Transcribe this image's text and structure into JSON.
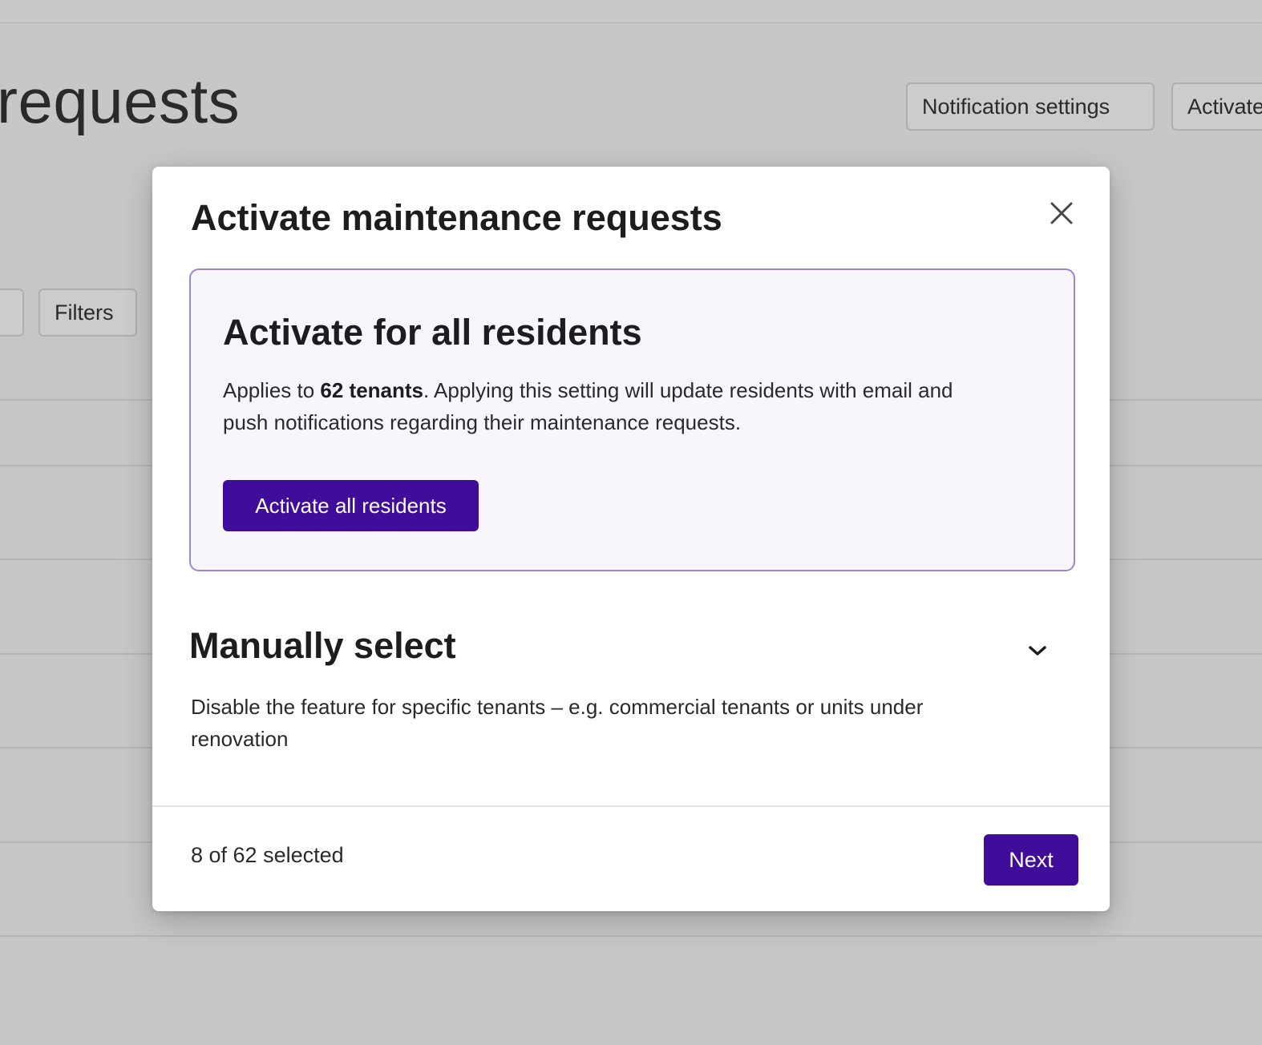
{
  "background": {
    "page_title": "requests",
    "notification_settings_label": "Notification settings",
    "activate_label": "Activate",
    "filters_label": "Filters"
  },
  "modal": {
    "title": "Activate maintenance requests",
    "all_residents": {
      "title": "Activate for all residents",
      "desc_prefix": "Applies to ",
      "tenant_count": "62 tenants",
      "desc_suffix": ". Applying this setting will update residents with email and push notifications regarding their maintenance requests.",
      "button_label": "Activate all residents"
    },
    "manual": {
      "title": "Manually select",
      "description": "Disable the feature for specific tenants – e.g. commercial tenants or units under renovation"
    },
    "footer": {
      "selected_text": "8 of 62 selected",
      "next_label": "Next"
    }
  },
  "colors": {
    "primary": "#3f0d99",
    "card_background": "#f9f5fc",
    "card_border": "#9c87cf",
    "overlay": "#c6c7c9"
  },
  "icons": {
    "close": "close-icon",
    "expand": "chevron-down-icon"
  }
}
